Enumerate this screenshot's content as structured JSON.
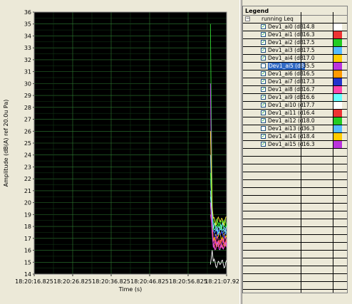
{
  "chart_data": {
    "type": "line",
    "title": "",
    "xlabel": "Time (s)",
    "ylabel": "Amplitude (dB(A) ref 20.0u Pa)",
    "ylim": [
      14,
      36
    ],
    "yticks": [
      "14",
      "15",
      "16",
      "17",
      "18",
      "19",
      "20",
      "21",
      "22",
      "23",
      "24",
      "25",
      "26",
      "27",
      "28",
      "29",
      "30",
      "31",
      "32",
      "33",
      "34",
      "35",
      "36"
    ],
    "xticks": [
      "18:20:16.825",
      "18:20:26.825",
      "18:20:36.825",
      "18:20:46.825",
      "18:20:56.825",
      "18:21:07.92"
    ],
    "background": "#000000",
    "grid_color": "#2e7d32",
    "series": [
      {
        "color": "#ffffff",
        "spike": 14.8,
        "level": 14.9
      },
      {
        "color": "#ff3333",
        "spike": 21.0,
        "level": 16.4
      },
      {
        "color": "#33dd33",
        "spike": 35.0,
        "level": 18.3
      },
      {
        "color": "#66ccff",
        "spike": 24.0,
        "level": 17.6
      },
      {
        "color": "#ffcc00",
        "spike": 22.0,
        "level": 17.2
      },
      {
        "color": "#cc44ff",
        "spike": 30.0,
        "level": 16.6
      },
      {
        "color": "#ff9900",
        "spike": 20.0,
        "level": 16.7
      },
      {
        "color": "#3333ff",
        "spike": 22.0,
        "level": 17.4
      },
      {
        "color": "#ff44aa",
        "spike": 19.0,
        "level": 16.8
      },
      {
        "color": "#66ffff",
        "spike": 20.5,
        "level": 17.8
      },
      {
        "color": "#ff5555",
        "spike": 20.0,
        "level": 16.5
      },
      {
        "color": "#22ee22",
        "spike": 22.5,
        "level": 18.1
      },
      {
        "color": "#88ddff",
        "spike": 21.0,
        "level": 17.9
      },
      {
        "color": "#ffee33",
        "spike": 26.0,
        "level": 18.5
      },
      {
        "color": "#dd55ff",
        "spike": 20.0,
        "level": 16.3
      }
    ]
  },
  "legend": {
    "header": "Legend",
    "group_label": "running Leq",
    "items": [
      {
        "name": "Dev1_ai0 (dB",
        "value": "14.8",
        "checked": true,
        "selected": false,
        "color": "#ffffff"
      },
      {
        "name": "Dev1_ai1 (dB",
        "value": "16.3",
        "checked": true,
        "selected": false,
        "color": "#ee3333"
      },
      {
        "name": "Dev1_ai2 (dB",
        "value": "17.5",
        "checked": true,
        "selected": false,
        "color": "#22cc22"
      },
      {
        "name": "Dev1_ai3 (dB",
        "value": "17.5",
        "checked": true,
        "selected": false,
        "color": "#55bbff"
      },
      {
        "name": "Dev1_ai4 (dB",
        "value": "17.0",
        "checked": true,
        "selected": false,
        "color": "#ffcc00"
      },
      {
        "name": "Dev1_ai5 (dB",
        "value": "35.5",
        "checked": false,
        "selected": true,
        "color": "#bb33dd"
      },
      {
        "name": "Dev1_ai6 (dB",
        "value": "16.5",
        "checked": true,
        "selected": false,
        "color": "#ff9900"
      },
      {
        "name": "Dev1_ai7 (dB",
        "value": "17.3",
        "checked": true,
        "selected": false,
        "color": "#2233cc"
      },
      {
        "name": "Dev1_ai8 (dB",
        "value": "16.7",
        "checked": true,
        "selected": false,
        "color": "#ff44aa"
      },
      {
        "name": "Dev1_ai9 (dB",
        "value": "16.6",
        "checked": true,
        "selected": false,
        "color": "#66ffff"
      },
      {
        "name": "Dev1_ai10 (d",
        "value": "17.7",
        "checked": true,
        "selected": false,
        "color": "#ffffff"
      },
      {
        "name": "Dev1_ai11 (d",
        "value": "16.4",
        "checked": true,
        "selected": false,
        "color": "#ee3333"
      },
      {
        "name": "Dev1_ai12 (d",
        "value": "18.0",
        "checked": true,
        "selected": false,
        "color": "#22cc22"
      },
      {
        "name": "Dev1_ai13 (d",
        "value": "36.3",
        "checked": false,
        "selected": false,
        "color": "#55bbff"
      },
      {
        "name": "Dev1_ai14 (d",
        "value": "18.4",
        "checked": true,
        "selected": false,
        "color": "#ffcc00"
      },
      {
        "name": "Dev1_ai15 (d",
        "value": "16.3",
        "checked": true,
        "selected": false,
        "color": "#bb33dd"
      }
    ]
  }
}
